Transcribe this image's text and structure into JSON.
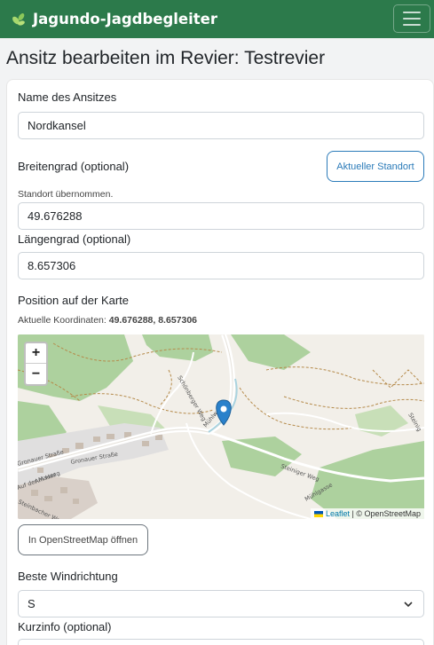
{
  "navbar": {
    "brand": "Jagundo-Jagdbegleiter"
  },
  "page": {
    "title": "Ansitz bearbeiten im Revier: Testrevier"
  },
  "form": {
    "name_label": "Name des Ansitzes",
    "name_value": "Nordkansel",
    "lat_label": "Breitengrad (optional)",
    "current_location_button": "Aktueller Standort",
    "location_status": "Standort übernommen.",
    "lat_value": "49.676288",
    "lng_label": "Längengrad (optional)",
    "lng_value": "8.657306",
    "map_label": "Position auf der Karte",
    "coords_prefix": "Aktuelle Koordinaten:",
    "coords_value": "49.676288, 8.657306",
    "osm_button": "In OpenStreetMap öffnen",
    "wind_label": "Beste Windrichtung",
    "wind_value": "S",
    "info_label": "Kurzinfo (optional)"
  },
  "map": {
    "zoom_in": "+",
    "zoom_out": "−",
    "attribution_leaflet": "Leaflet",
    "attribution_osm": "| © OpenStreetMap",
    "street_labels": [
      "Schönberger Weg",
      "Gronauer Straße",
      "Gronauer Straße",
      "Steiniger Weg",
      "Mühlgasse",
      "Auf der Mauer",
      "Am Haag",
      "Steinbacher Weg",
      "Mühlweg",
      "Steinig"
    ],
    "marker_color": "#2a81cb"
  },
  "colors": {
    "navbar": "#2c7a4b",
    "accent": "#2b7bb9"
  }
}
